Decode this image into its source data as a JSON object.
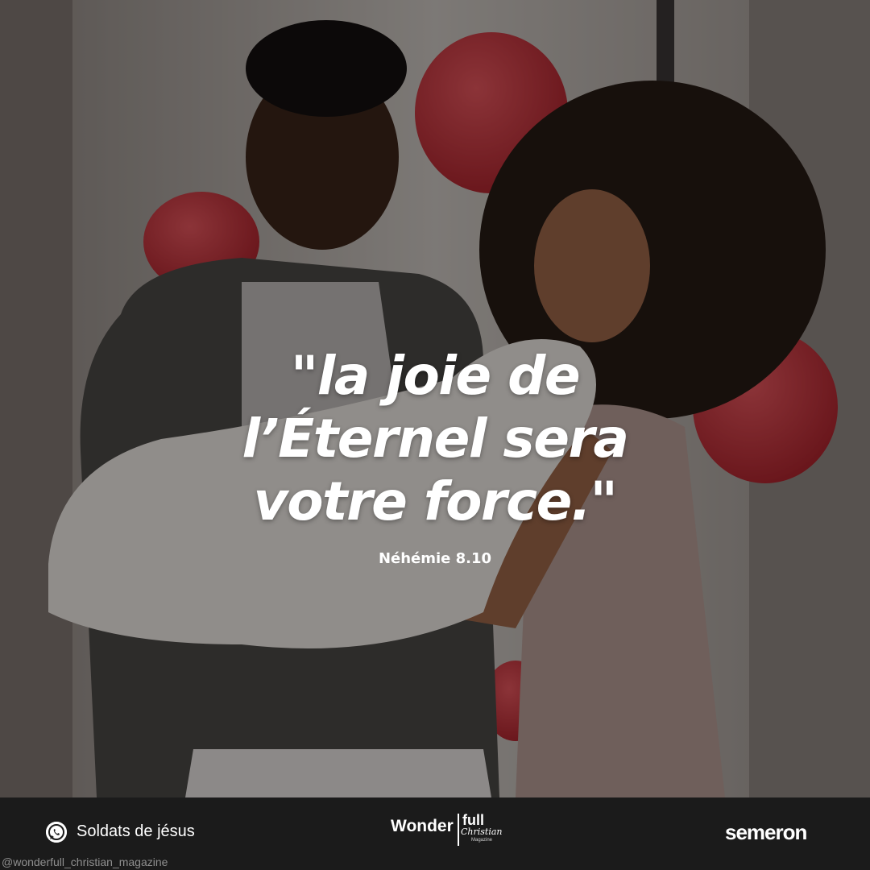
{
  "quote": {
    "lines": [
      "\"la joie de",
      "l’Éternel sera",
      "votre force.\""
    ],
    "reference": "Néhémie 8.10"
  },
  "footer": {
    "whatsapp_label": "Soldats de jésus",
    "handle": "@wonderfull_christian_magazine",
    "magazine_logo": {
      "wonder": "Wonder",
      "full": "full",
      "christian": "Christian",
      "magazine": "Magazine"
    },
    "brand": "semeron"
  },
  "colors": {
    "footer_background": "#1b1b1b",
    "text": "#ffffff",
    "balloon": "#c8323a"
  },
  "icons": [
    "whatsapp-icon"
  ]
}
